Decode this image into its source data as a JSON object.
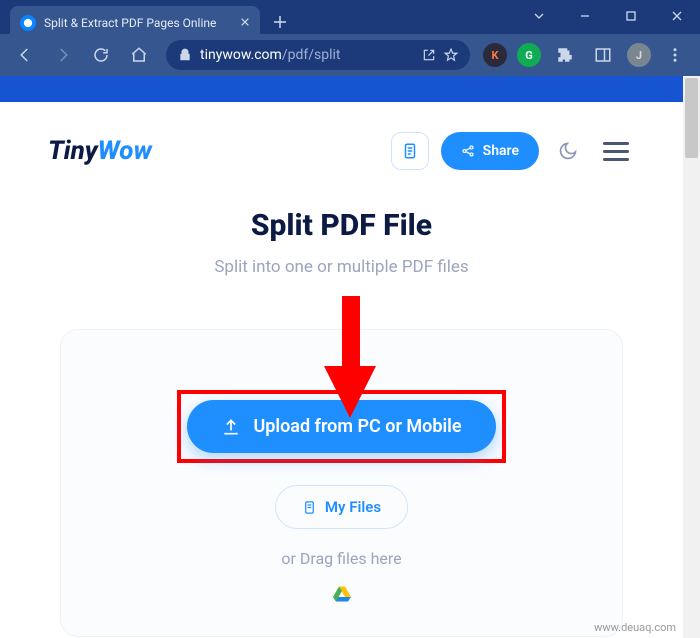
{
  "browser": {
    "tab_title": "Split & Extract PDF Pages Online",
    "url_host": "tinywow.com",
    "url_path": "/pdf/split"
  },
  "header": {
    "logo_part1": "Tiny",
    "logo_part2": "Wow",
    "share_label": "Share"
  },
  "main": {
    "title": "Split PDF File",
    "subtitle": "Split into one or multiple PDF files",
    "upload_button": "Upload from PC or Mobile",
    "myfiles_button": "My Files",
    "drag_text": "or Drag files here"
  },
  "watermark": "www.deuaq.com"
}
